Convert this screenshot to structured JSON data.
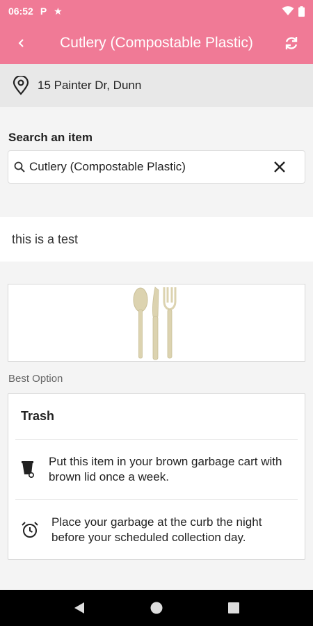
{
  "status_bar": {
    "time": "06:52",
    "icons": [
      "parking-icon",
      "star-icon",
      "wifi-icon",
      "battery-icon"
    ]
  },
  "app_bar": {
    "title": "Cutlery (Compostable Plastic)"
  },
  "address": {
    "text": "15 Painter Dr, Dunn"
  },
  "search": {
    "label": "Search an item",
    "value": "Cutlery (Compostable Plastic)"
  },
  "note": "this is a test",
  "best_option": {
    "label": "Best Option",
    "title": "Trash",
    "instructions": [
      {
        "icon": "garbage-cart-icon",
        "text": "Put this item in your brown garbage cart with brown lid once a week."
      },
      {
        "icon": "alarm-clock-icon",
        "text": "Place your garbage at the curb the night before your scheduled collection day."
      }
    ]
  },
  "colors": {
    "accent": "#f07a96"
  }
}
